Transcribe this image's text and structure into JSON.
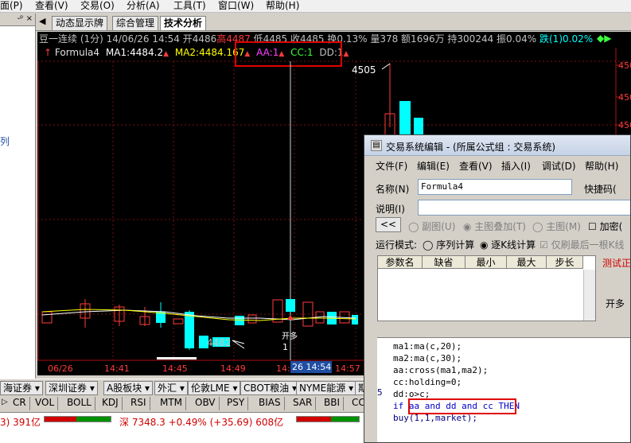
{
  "menubar": {
    "items": [
      "面(P)",
      "查看(V)",
      "交易(O)",
      "分析(A)",
      "工具(T)",
      "窗口(W)",
      "帮助(H)"
    ]
  },
  "leftpanel": {
    "pin": "-ᵖ ×",
    "vertical_text": "列"
  },
  "tabs": [
    "动态显示牌",
    "综合管理",
    "技术分析"
  ],
  "chart": {
    "header": "豆一连续 (1分) 14/06/26 14:54 开4486",
    "header_high": "高4487",
    "header_low": "低4485",
    "header_close": "收4485",
    "header_rest": "换0.13% 量378 额1696万 持300244 振0.04%",
    "header_rise": "跌(1)0.02%",
    "formula_name": "Formula4",
    "ma1": "MA1:4484.2",
    "ma2": "MA2:4484.167",
    "aa": "AA:1",
    "cc": "CC:1",
    "dd": "DD:1",
    "price_high_label": "4505",
    "price_low_label": "4482",
    "signal_label": "开多",
    "signal_num": "1",
    "time_axis": [
      "06/26",
      "14:41",
      "14:45",
      "14:49",
      "14:",
      "14:57"
    ],
    "time_cursor": "26 14:54",
    "right_axis": [
      "450",
      "450",
      "450"
    ]
  },
  "bottom_tabs": [
    "海证券",
    "深圳证券",
    "A股板块",
    "外汇",
    "伦敦LME",
    "CBOT粮油",
    "NYME能源",
    "期"
  ],
  "indicator_tabs": [
    "CR",
    "VOL",
    "BOLL",
    "KDJ",
    "RSI",
    "MTM",
    "OBV",
    "PSY",
    "BIAS",
    "SAR",
    "BBI",
    "CC"
  ],
  "status": {
    "left": "3) 391亿",
    "shenzhen": "深 7348.3 +0.49% (+35.69) 608亿"
  },
  "dialog": {
    "title": "交易系统编辑 - (所属公式组 : 交易系统)",
    "menu": [
      "文件(F)",
      "编辑(E)",
      "查看(V)",
      "插入(I)",
      "调试(D)",
      "帮助(H)"
    ],
    "name_label": "名称(N)",
    "name_value": "Formula4",
    "shortcut_label": "快捷码(",
    "desc_label": "说明(I)",
    "back_btn": "<<",
    "radio_sub": "副图(U)",
    "radio_main_overlay": "主图叠加(T)",
    "radio_main": "主图(M)",
    "encrypt": "加密(",
    "run_mode_label": "运行模式:",
    "run_seq": "序列计算",
    "run_tick": "逐K线计算",
    "only_last": "仅刷最后一根K线",
    "param_headers": [
      "参数名",
      "缺省",
      "最小",
      "最大",
      "步长"
    ],
    "test_btn": "测试正",
    "open_long_btn": "开多",
    "line_number": "5",
    "code_lines": [
      "ma1:ma(c,20);",
      "ma2:ma(c,30);",
      "aa:cross(ma1,ma2);",
      "cc:holding=0;",
      "dd:o>c;",
      "if aa and dd and cc THEN",
      "buy(1,1,market);"
    ]
  }
}
